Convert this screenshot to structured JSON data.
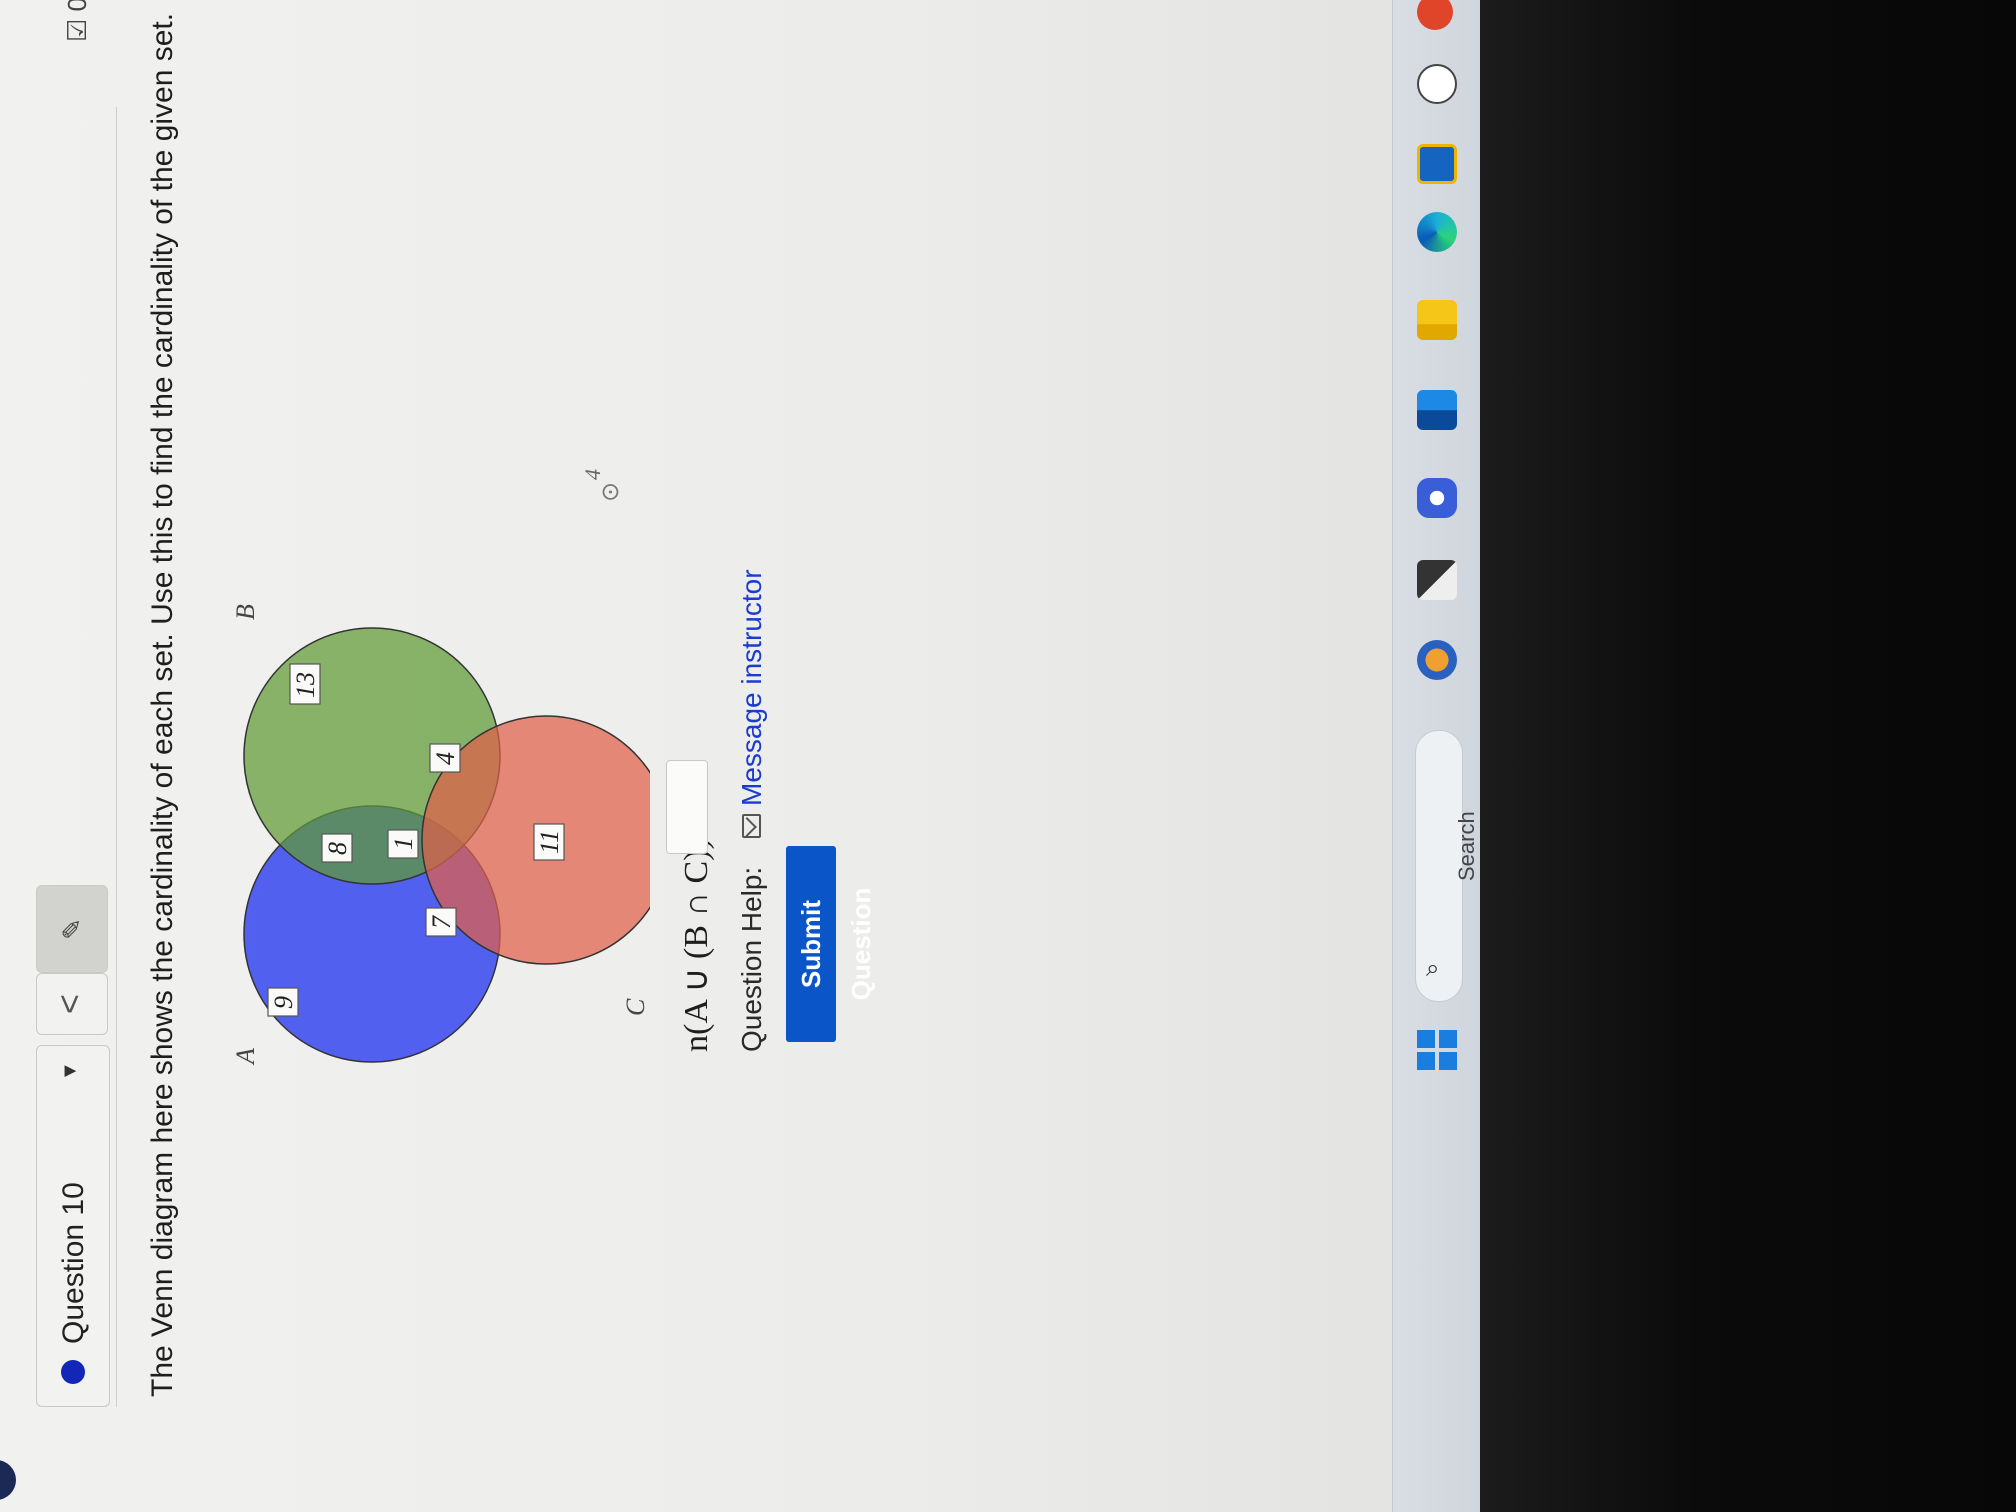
{
  "question": {
    "label": "Question 10",
    "caret": "▼",
    "prev_icon": "<",
    "edit_icon": "✎",
    "score": "☑ 0"
  },
  "instructions": "The Venn diagram here shows the cardinality of each set. Use this to find the cardinality of the given set.",
  "venn": {
    "sets": [
      {
        "name": "A",
        "color": "#3c4cf0"
      },
      {
        "name": "B",
        "color": "#5e9a34"
      },
      {
        "name": "C",
        "color": "#e0604a"
      }
    ],
    "regions": {
      "A_only": "9",
      "A_B_only": "8",
      "B_only": "13",
      "A_B_C": "1",
      "A_C_only": "7",
      "B_C_only": "4",
      "C_only": "11"
    },
    "outside": "4"
  },
  "expression": "n(A ∪ (B ∩ C)) =",
  "answer_value": "",
  "help": {
    "label": "Question Help:",
    "link": "Message instructor"
  },
  "submit_label": "Submit Question",
  "taskbar": {
    "search_label": "Search"
  }
}
